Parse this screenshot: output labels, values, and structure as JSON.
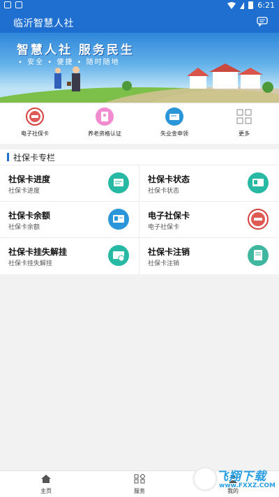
{
  "status_bar": {
    "time": "6:21"
  },
  "app": {
    "title": "临沂智慧人社"
  },
  "banner": {
    "slogan": "智慧人社 服务民生",
    "subtitle": "• 安全 • 便捷 • 随时随地"
  },
  "quick_actions": [
    {
      "label": "电子社保卡",
      "icon": "social-card-seal-icon"
    },
    {
      "label": "养老资格认证",
      "icon": "pension-auth-icon"
    },
    {
      "label": "失业金申领",
      "icon": "unemployment-card-icon"
    },
    {
      "label": "更多",
      "icon": "grid-more-icon"
    }
  ],
  "section": {
    "title": "社保卡专栏"
  },
  "cards": [
    {
      "title": "社保卡进度",
      "subtitle": "社保卡进度",
      "icon": "card-progress-icon",
      "color": "#27b9a4"
    },
    {
      "title": "社保卡状态",
      "subtitle": "社保卡状态",
      "icon": "card-status-icon",
      "color": "#27b9a4"
    },
    {
      "title": "社保卡余额",
      "subtitle": "社保卡余额",
      "icon": "card-balance-icon",
      "color": "#2a95d8"
    },
    {
      "title": "电子社保卡",
      "subtitle": "电子社保卡",
      "icon": "e-social-card-seal-icon",
      "color": "#d5403d"
    },
    {
      "title": "社保卡挂失解挂",
      "subtitle": "社保卡挂失解挂",
      "icon": "card-loss-report-icon",
      "color": "#27b9a4"
    },
    {
      "title": "社保卡注销",
      "subtitle": "社保卡注销",
      "icon": "card-cancel-icon",
      "color": "#3fb6a0"
    }
  ],
  "bottom_nav": [
    {
      "label": "主页",
      "icon": "home-icon"
    },
    {
      "label": "服务",
      "icon": "services-grid-icon"
    },
    {
      "label": "我的",
      "icon": "profile-icon"
    }
  ],
  "watermark": {
    "text": "飞翔下载",
    "url": "www.FXXZ.COM"
  },
  "colors": {
    "primary": "#1e6fcf",
    "teal": "#27b9a4",
    "red": "#d5403d"
  }
}
